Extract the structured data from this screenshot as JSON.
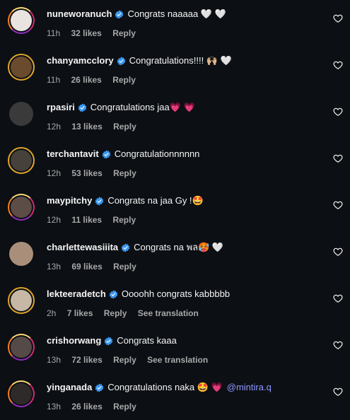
{
  "comments": [
    {
      "username": "nuneworanuch",
      "text": "Congrats naaaaa 🤍 🤍",
      "mention": "",
      "time": "11h",
      "likes": "32 likes",
      "reply": "Reply",
      "translate": ""
    },
    {
      "username": "chanyamcclory",
      "text": "Congratulations!!!! 🙌🏼 🤍",
      "mention": "",
      "time": "11h",
      "likes": "26 likes",
      "reply": "Reply",
      "translate": ""
    },
    {
      "username": "rpasiri",
      "text": "Congratulations jaa💗 💗",
      "mention": "",
      "time": "12h",
      "likes": "13 likes",
      "reply": "Reply",
      "translate": ""
    },
    {
      "username": "terchantavit",
      "text": "Congratulationnnnnn",
      "mention": "",
      "time": "12h",
      "likes": "53 likes",
      "reply": "Reply",
      "translate": ""
    },
    {
      "username": "maypitchy",
      "text": "Congrats na jaa Gy !🤩",
      "mention": "",
      "time": "12h",
      "likes": "11 likes",
      "reply": "Reply",
      "translate": ""
    },
    {
      "username": "charlettewasiiita",
      "text": "Congrats na พล🥵 🤍",
      "mention": "",
      "time": "13h",
      "likes": "69 likes",
      "reply": "Reply",
      "translate": ""
    },
    {
      "username": "lekteeradetch",
      "text": "Oooohh congrats kabbbbb",
      "mention": "",
      "time": "2h",
      "likes": "7 likes",
      "reply": "Reply",
      "translate": "See translation"
    },
    {
      "username": "crishorwang",
      "text": "Congrats kaaa",
      "mention": "",
      "time": "13h",
      "likes": "72 likes",
      "reply": "Reply",
      "translate": "See translation"
    },
    {
      "username": "yinganada",
      "text": "Congratulations naka 🤩 💗",
      "mention": "@mintira.q",
      "time": "13h",
      "likes": "26 likes",
      "reply": "Reply",
      "translate": ""
    }
  ],
  "colors": {
    "background": "#0c0f14",
    "verified": "#3897f0",
    "mention": "#8e98ff",
    "meta": "#a8a8a8"
  },
  "icons": {
    "verified": "verified-badge-icon",
    "like": "heart-outline-icon"
  }
}
